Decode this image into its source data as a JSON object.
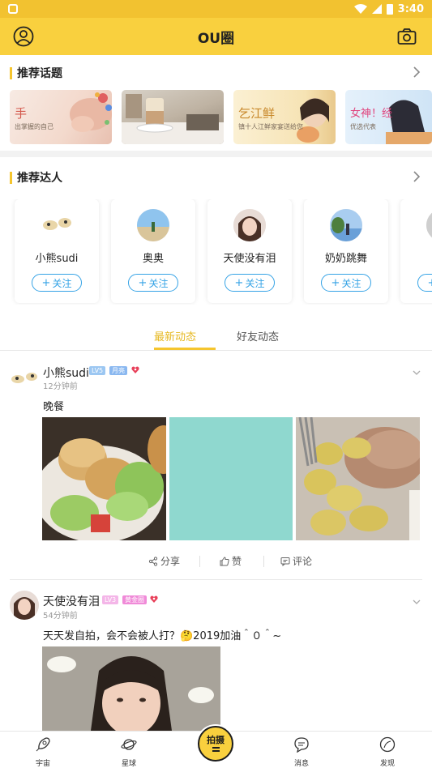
{
  "status_bar": {
    "time": "3:40"
  },
  "app_bar": {
    "title": "OU圈"
  },
  "recommended_topics": {
    "title": "推荐话题",
    "topics": [
      {
        "main_text": "手",
        "sub_text": "出掌握的自己"
      },
      {
        "main_text": "",
        "sub_text": ""
      },
      {
        "main_text": "乞江鲜",
        "sub_text": "镇十人江鲜家宴送给您"
      },
      {
        "main_text": "女神！经",
        "sub_text": "优选代表"
      }
    ]
  },
  "recommended_talents": {
    "title": "推荐达人",
    "follow_label": "关注",
    "follow_plus": "+",
    "talents": [
      {
        "name": "小熊sudi"
      },
      {
        "name": "奥奥"
      },
      {
        "name": "天使没有泪"
      },
      {
        "name": "奶奶跳舞"
      },
      {
        "name": "一"
      }
    ]
  },
  "feed_tabs": {
    "tabs": [
      "最新动态",
      "好友动态"
    ],
    "active": 0
  },
  "posts": [
    {
      "username": "小熊sudi",
      "level": "LV5",
      "title_badge": "月亮",
      "time": "12分钟前",
      "text": "晚餐",
      "actions": {
        "share": "分享",
        "like": "赞",
        "comment": "评论"
      }
    },
    {
      "username": "天使没有泪",
      "level": "LV3",
      "title_badge": "黄金圈",
      "time": "54分钟前",
      "text": "天天发自拍，会不会被人打？🤔2019加油＾０＾~"
    }
  ],
  "bottom_nav": {
    "items": [
      "宇宙",
      "星球",
      "消息",
      "发现"
    ],
    "shoot_label": "拍摄"
  },
  "colors": {
    "brand_yellow": "#f9d03e",
    "accent_blue": "#35a3e6",
    "active_tab": "#e6b820"
  }
}
